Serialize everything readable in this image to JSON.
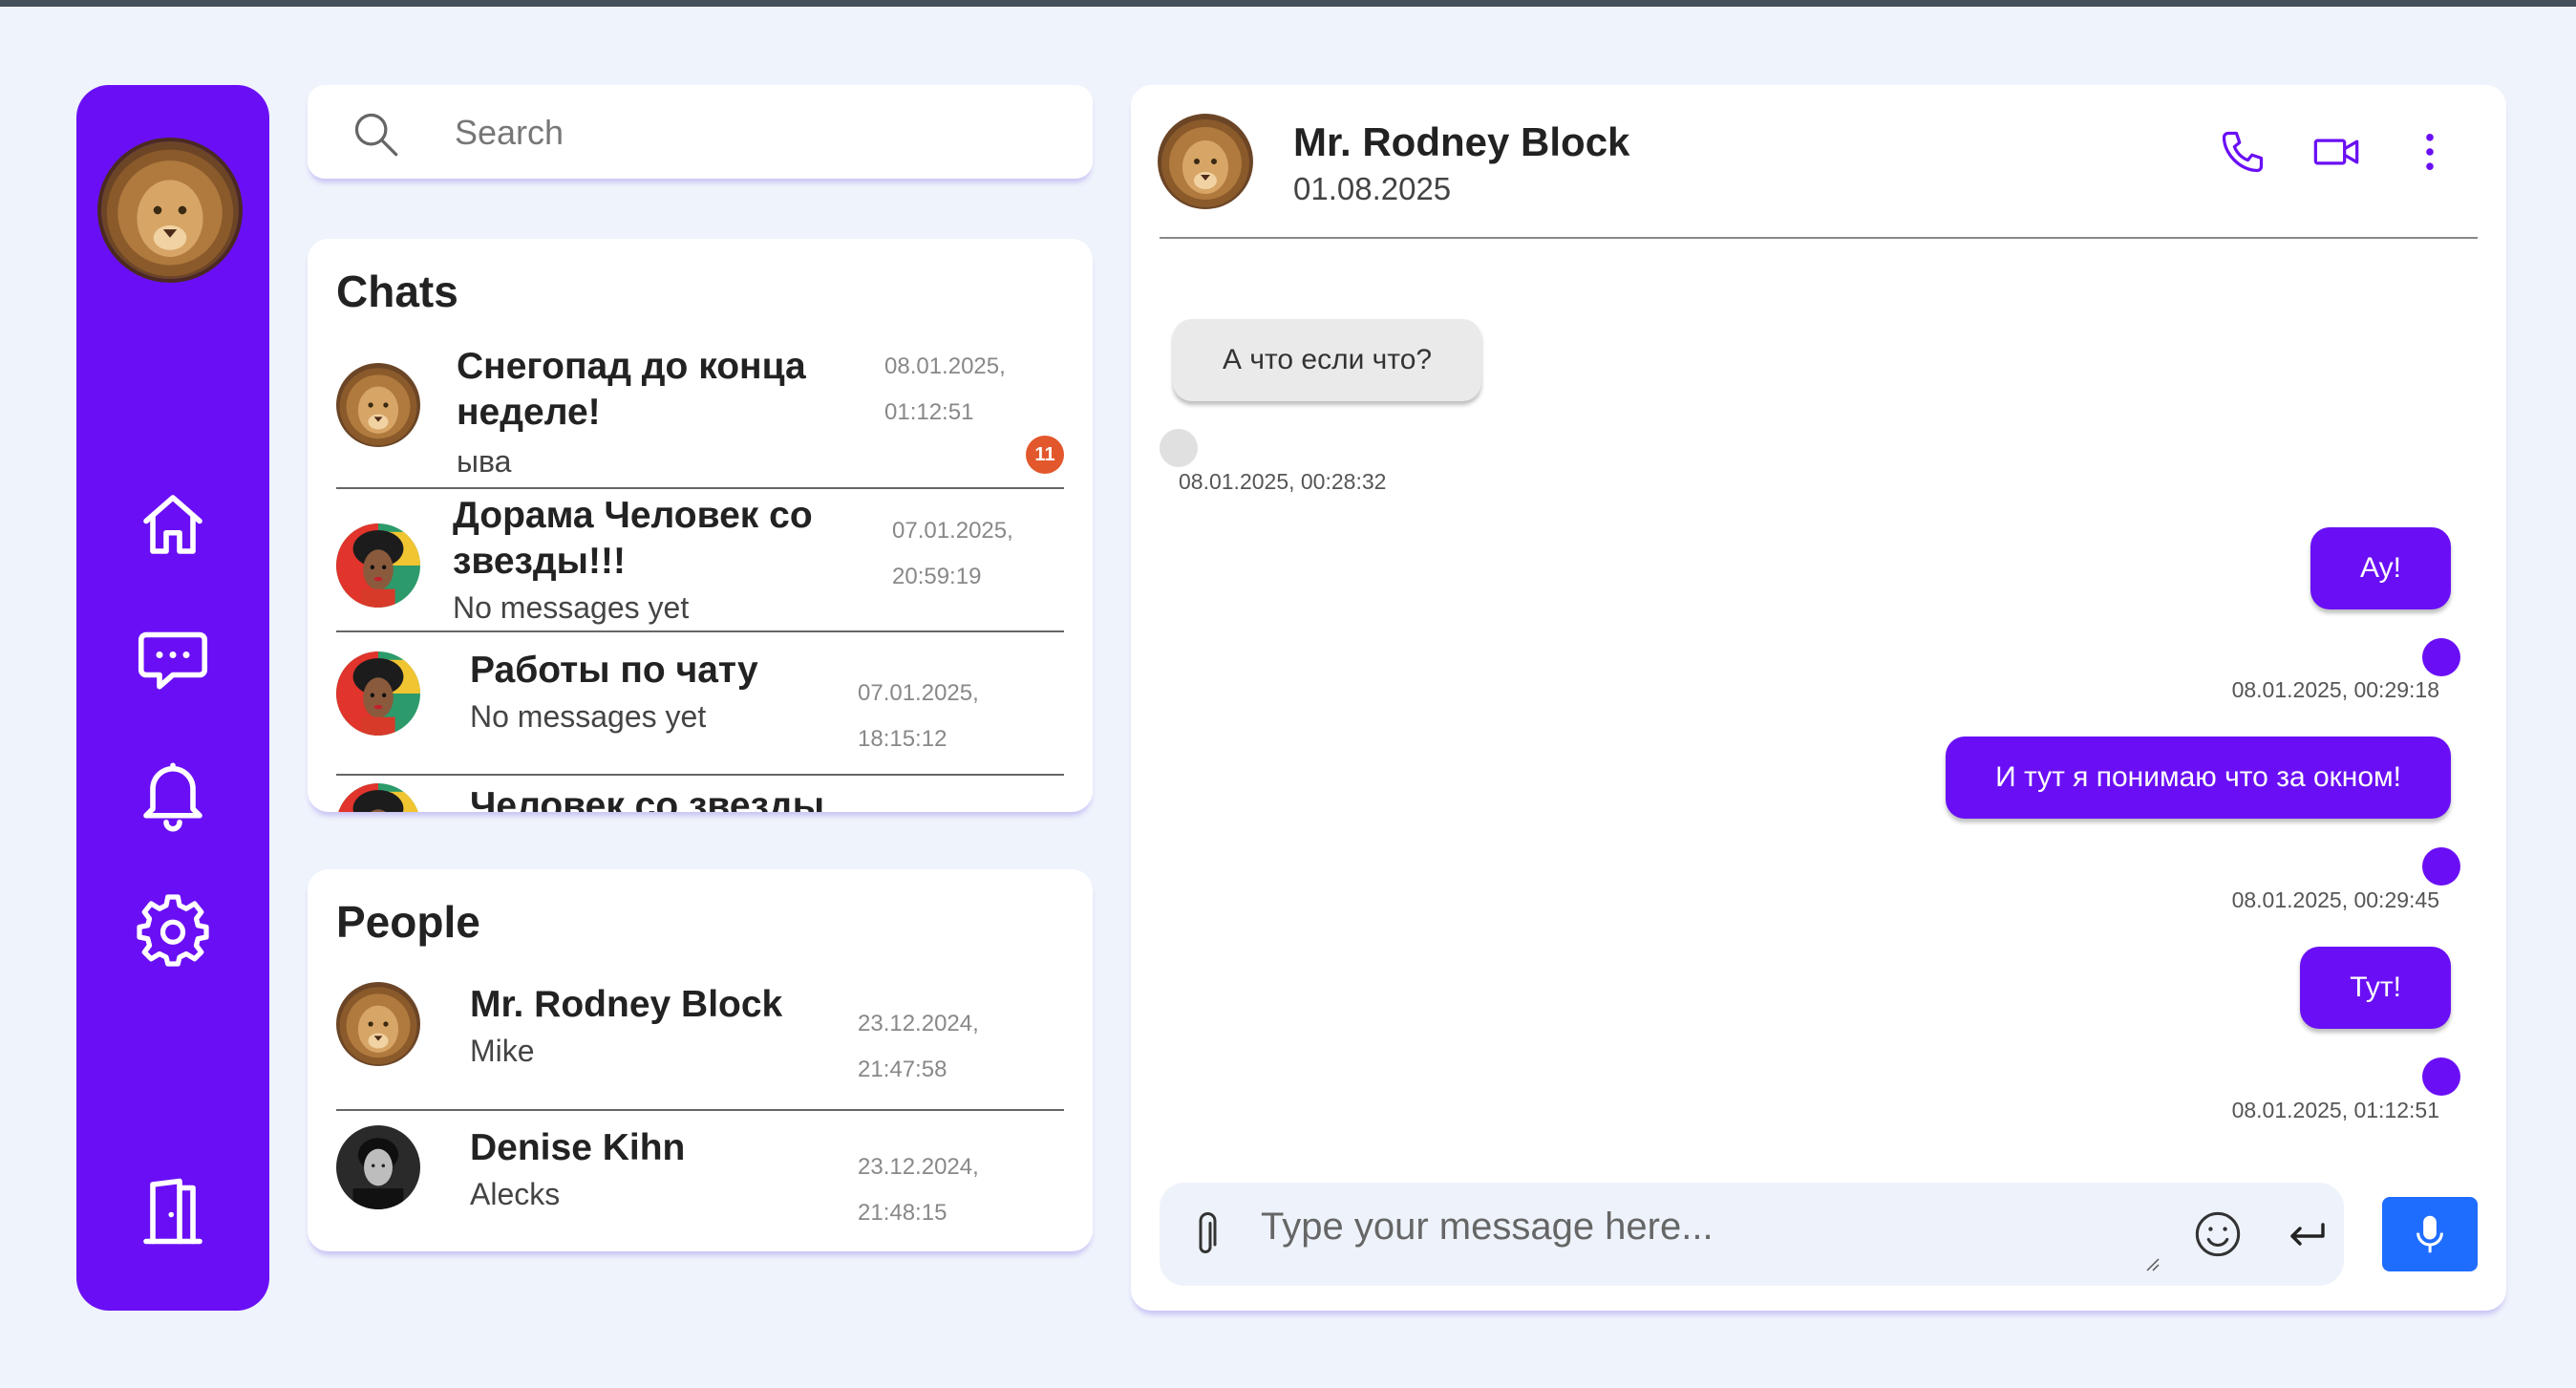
{
  "search": {
    "placeholder": "Search"
  },
  "sidebar": {
    "items": [
      {
        "icon": "home-icon"
      },
      {
        "icon": "chat-bubble-icon"
      },
      {
        "icon": "bell-icon"
      },
      {
        "icon": "gear-icon"
      },
      {
        "icon": "logout-door-icon"
      }
    ]
  },
  "chats": {
    "title": "Chats",
    "items": [
      {
        "name_line1": "Снегопад до конца",
        "name_line2": "неделе!",
        "preview": "ыва",
        "time_line1": "08.01.2025,",
        "time_line2": "01:12:51",
        "unread": "11",
        "avatar": "lion"
      },
      {
        "name_line1": "Дорама Человек со",
        "name_line2": "звезды!!!",
        "preview": "No messages yet",
        "time_line1": "07.01.2025,",
        "time_line2": "20:59:19",
        "avatar": "woman"
      },
      {
        "name_line1": "Работы по чату",
        "preview": "No messages yet",
        "time_line1": "07.01.2025, 18:15:12",
        "avatar": "woman"
      },
      {
        "name_line1": "Человек со звезды",
        "avatar": "woman"
      }
    ]
  },
  "people": {
    "title": "People",
    "items": [
      {
        "name": "Mr. Rodney Block",
        "subtitle": "Mike",
        "time": "23.12.2024, 21:47:58",
        "avatar": "lion"
      },
      {
        "name": "Denise Kihn",
        "subtitle": "Alecks",
        "time": "23.12.2024, 21:48:15",
        "avatar": "man"
      }
    ]
  },
  "conversation": {
    "name": "Mr. Rodney Block",
    "date": "01.08.2025",
    "messages": [
      {
        "direction": "in",
        "text": "А что если что?",
        "time": "08.01.2025, 00:28:32"
      },
      {
        "direction": "out",
        "text": "Ау!",
        "time": "08.01.2025, 00:29:18"
      },
      {
        "direction": "out",
        "text": "И тут я понимаю что за окном!",
        "time": "08.01.2025, 00:29:45"
      },
      {
        "direction": "out",
        "text": "Тут!",
        "time": "08.01.2025, 01:12:51"
      }
    ],
    "composer_placeholder": "Type your message here..."
  },
  "colors": {
    "accent": "#6a0ff5",
    "badge": "#e2572b",
    "mic": "#1f6dff",
    "background": "#eff3fb"
  }
}
